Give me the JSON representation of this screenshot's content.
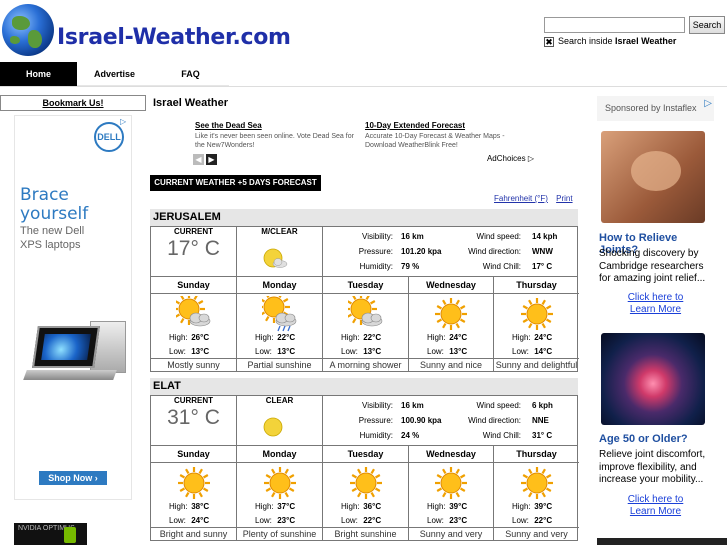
{
  "header": {
    "site_title": "Israel-Weather.com",
    "search_button": "Search",
    "search_placeholder": "",
    "search_inside_prefix": "Search inside ",
    "search_inside_site": "Israel Weather"
  },
  "nav": {
    "items": [
      {
        "label": "Home",
        "active": true
      },
      {
        "label": "Advertise"
      },
      {
        "label": "FAQ"
      }
    ]
  },
  "left": {
    "bookmark_label": "Bookmark Us!",
    "dell_ad": {
      "logo": "DELL",
      "headline_1": "Brace",
      "headline_2": "yourself",
      "sub_1": "The new Dell",
      "sub_2": "XPS laptops",
      "cta": "Shop Now ›"
    },
    "nvidia_text": "NVIDIA OPTIMUS"
  },
  "main": {
    "section_title": "Israel Weather",
    "google_ad": {
      "ad1_title": "See the Dead Sea",
      "ad1_desc": "Like it's never been seen online. Vote Dead Sea for the New7Wonders!",
      "ad2_title": "10-Day Extended Forecast",
      "ad2_desc": "Accurate 10-Day Forecast & Weather Maps - Download WeatherBlink Free!",
      "adchoices": "AdChoices ▷"
    },
    "forecast_banner": "CURRENT WEATHER +5 DAYS FORECAST",
    "link_fahrenheit": "Fahrenheit (°F)",
    "link_print": "Print",
    "labels": {
      "current": "CURRENT",
      "visibility": "Visibility:",
      "pressure": "Pressure:",
      "humidity": "Humidity:",
      "wind_speed": "Wind speed:",
      "wind_direction": "Wind direction:",
      "wind_chill": "Wind Chill:",
      "high": "High:",
      "low": "Low:"
    },
    "cities": [
      {
        "name": "JERUSALEM",
        "current_temp": "17° C",
        "condition": "M/CLEAR",
        "visibility": "16 km",
        "pressure": "101.20 kpa",
        "humidity": "79 %",
        "wind_speed": "14 kph",
        "wind_direction": "WNW",
        "wind_chill": "17° C",
        "days": [
          {
            "name": "Sunday",
            "icon": "sun-cloud-icon",
            "high": "26°C",
            "low": "13°C",
            "desc": "Mostly sunny"
          },
          {
            "name": "Monday",
            "icon": "sun-rain-cloud-icon",
            "high": "22°C",
            "low": "13°C",
            "desc": "Partial sunshine"
          },
          {
            "name": "Tuesday",
            "icon": "sun-cloud-icon",
            "high": "22°C",
            "low": "13°C",
            "desc": "A morning shower"
          },
          {
            "name": "Wednesday",
            "icon": "sun-icon",
            "high": "24°C",
            "low": "13°C",
            "desc": "Sunny and nice"
          },
          {
            "name": "Thursday",
            "icon": "sun-icon",
            "high": "24°C",
            "low": "14°C",
            "desc": "Sunny and delightful"
          }
        ]
      },
      {
        "name": "ELAT",
        "current_temp": "31° C",
        "condition": "CLEAR",
        "visibility": "16 km",
        "pressure": "100.90 kpa",
        "humidity": "24 %",
        "wind_speed": "6 kph",
        "wind_direction": "NNE",
        "wind_chill": "31° C",
        "days": [
          {
            "name": "Sunday",
            "icon": "sun-icon",
            "high": "38°C",
            "low": "24°C",
            "desc": "Bright and sunny"
          },
          {
            "name": "Monday",
            "icon": "sun-icon",
            "high": "37°C",
            "low": "23°C",
            "desc": "Plenty of sunshine"
          },
          {
            "name": "Tuesday",
            "icon": "sun-icon",
            "high": "36°C",
            "low": "22°C",
            "desc": "Bright sunshine"
          },
          {
            "name": "Wednesday",
            "icon": "sun-icon",
            "high": "39°C",
            "low": "23°C",
            "desc": "Sunny and very"
          },
          {
            "name": "Thursday",
            "icon": "sun-icon",
            "high": "39°C",
            "low": "22°C",
            "desc": "Sunny and very"
          }
        ]
      }
    ]
  },
  "right_ad": {
    "sponsor": "Sponsored by Instaflex",
    "ad1_title": "How to Relieve Joints?",
    "ad1_text": "Shocking discovery by Cambridge researchers for amazing joint relief...",
    "ad1_link_1": "Click here to",
    "ad1_link_2": "Learn More",
    "ad2_title": "Age 50 or Older?",
    "ad2_text": "Relieve joint discomfort, improve flexibility, and increase your mobility...",
    "ad2_link_1": "Click here to",
    "ad2_link_2": "Learn More"
  }
}
